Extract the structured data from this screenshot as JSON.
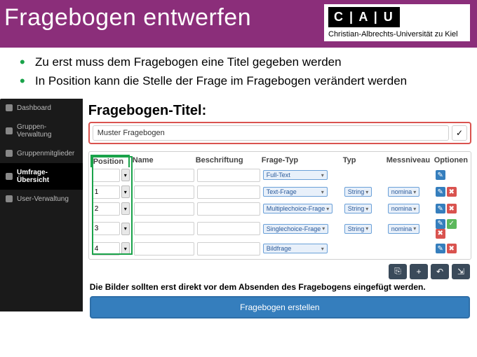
{
  "header": {
    "title": "Fragebogen entwerfen",
    "uni_abbr": "C | A | U",
    "uni_name": "Christian-Albrechts-Universität zu Kiel"
  },
  "bullets": [
    "Zu erst muss dem Fragebogen eine Titel gegeben werden",
    "In Position kann die Stelle der Frage im Fragebogen verändert werden"
  ],
  "sidebar": {
    "items": [
      {
        "label": "Dashboard"
      },
      {
        "label": "Gruppen-Verwaltung"
      },
      {
        "label": "Gruppenmitglieder"
      },
      {
        "label": "Umfrage-Übersicht",
        "selected": true
      },
      {
        "label": "User-Verwaltung"
      }
    ]
  },
  "form": {
    "title_label": "Fragebogen-Titel:",
    "title_value": "Muster Fragebogen",
    "columns": {
      "pos": "Position",
      "name": "Name",
      "besch": "Beschriftung",
      "type": "Frage-Typ",
      "typ": "Typ",
      "mess": "Messniveau",
      "opt": "Optionen"
    },
    "rows": [
      {
        "pos": "",
        "type": "Full-Text",
        "typ": "",
        "mess": "",
        "opts": [
          "blue"
        ]
      },
      {
        "pos": "1",
        "type": "Text-Frage",
        "typ": "String",
        "mess": "nomina",
        "opts": [
          "blue",
          "red"
        ]
      },
      {
        "pos": "2",
        "type": "Multiplechoice-Frage",
        "typ": "String",
        "mess": "nomina",
        "opts": [
          "blue",
          "red"
        ]
      },
      {
        "pos": "3",
        "type": "Singlechoice-Frage",
        "typ": "String",
        "mess": "nomina",
        "opts": [
          "blue",
          "grn",
          "red"
        ]
      },
      {
        "pos": "4",
        "type": "Bildfrage",
        "typ": "",
        "mess": "",
        "opts": [
          "blue",
          "red"
        ]
      }
    ],
    "note": "Die Bilder sollten erst direkt vor dem Absenden des Fragebogens eingefügt werden.",
    "create_label": "Fragebogen erstellen"
  }
}
